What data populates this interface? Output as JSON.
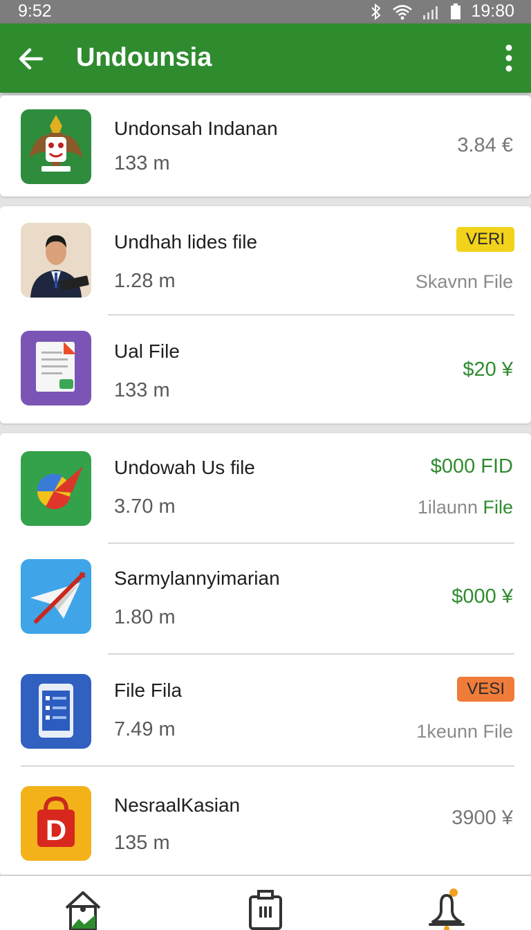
{
  "status_bar": {
    "time_left": "9:52",
    "time_right": "19:80"
  },
  "app_bar": {
    "title": "Undounsia"
  },
  "items": [
    {
      "name": "Undonsah Indanan",
      "size": "133 m",
      "price": "3.84 €",
      "price_color": "#777777",
      "icon": "garuda-emblem-icon"
    },
    {
      "name": "Undhah lides file",
      "size": "1.28 m",
      "badge": "VERI",
      "badge_color": "#f2d21a",
      "right_text": "Skavnn File",
      "icon": "man-with-tablet-photo"
    },
    {
      "name": "Ual File",
      "size": "133 m",
      "price": "$20 ¥",
      "price_color": "#2e8b2e",
      "icon": "document-file-icon"
    },
    {
      "name": "Undowah Us file",
      "size": "3.70 m",
      "price": "$000 FID",
      "price_color": "#2e8b2e",
      "right_text_gray": "1ilaunn",
      "right_text_green": "File",
      "icon": "compass-arrow-icon"
    },
    {
      "name": "Sarmylannyimarian",
      "size": "1.80 m",
      "price": "$000 ¥",
      "price_color": "#2e8b2e",
      "icon": "paper-plane-icon"
    },
    {
      "name": "File Fila",
      "size": "7.49 m",
      "badge": "VESI",
      "badge_color": "#f07c3a",
      "right_text": "1keunn File",
      "icon": "tablet-checklist-icon"
    },
    {
      "name": "NesraalKasian",
      "size": "135 m",
      "price": "3900 ¥",
      "price_color": "#777777",
      "icon": "shopping-bag-d-icon"
    }
  ],
  "bottom_nav": {
    "icons": [
      "home-icon",
      "storage-icon",
      "notification-bell-icon"
    ]
  }
}
